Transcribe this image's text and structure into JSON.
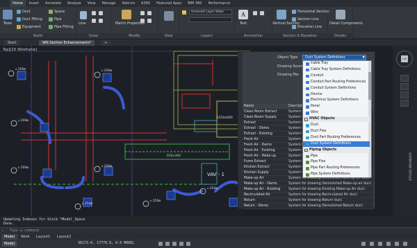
{
  "ribbon": {
    "tabs": [
      "Home",
      "Insert",
      "Annotate",
      "Analyze",
      "View",
      "Manage",
      "Add-ins",
      "A360",
      "Featured Apps",
      "BIM 360",
      "Performance"
    ],
    "active_tab": "Home",
    "build": {
      "tools": "Tools",
      "duct": "Duct",
      "duct_fitting": "Duct Fitting",
      "equipment": "Equipment",
      "space": "Space",
      "pipe": "Pipe",
      "pipe_fitting": "Pipe Fitting",
      "title": "Build"
    },
    "draw": {
      "line": "Line",
      "title": "Draw"
    },
    "modify": {
      "match_properties": "Match Properties",
      "title": "Modify"
    },
    "view": {
      "title": "View"
    },
    "layers": {
      "layer_state": "Unsaved Layer State",
      "title": "Layers"
    },
    "annotation": {
      "text": "Text",
      "title": "Annotation"
    },
    "section": {
      "vertical_section": "Vertical Section",
      "horizontal_section": "Horizontal Section",
      "section_line": "Section Line",
      "elevation_line": "Elevation Line",
      "title": "Section & Elevation"
    },
    "details": {
      "detail_components": "Detail Components",
      "title": "Details"
    }
  },
  "doc_tabs": [
    "Start",
    "WN Section Enhancements*"
  ],
  "viewport_label": "Top][2D Wireframe]",
  "drawing": {
    "labels": [
      {
        "id": "A",
        "text": "200ø"
      },
      {
        "id": "A",
        "text": "200ø"
      },
      {
        "id": "A",
        "text": "200ø"
      },
      {
        "id": "A",
        "text": "200ø"
      },
      {
        "id": "A",
        "text": "200ø"
      },
      {
        "id": "A",
        "text": "250ø"
      },
      {
        "id": "A",
        "text": "250ø"
      },
      {
        "id": "A",
        "text": "250ø"
      }
    ],
    "vav_label": "VAV - 1",
    "duct_size": "650x300",
    "tag": "1250x600"
  },
  "panel": {
    "object_type_label": "Object Type",
    "object_type_value": "Duct System Definitions",
    "drawing_source_label": "Drawing Source",
    "drawing_file_label": "Drawing File",
    "grid_header": {
      "name": "Name",
      "desc": "Description"
    },
    "rows": [
      {
        "name": "Clean Room Extract",
        "desc": "System for"
      },
      {
        "name": "Clean Room Supply",
        "desc": "System for"
      },
      {
        "name": "Extract",
        "desc": "System for"
      },
      {
        "name": "Extract - Demo",
        "desc": "System for"
      },
      {
        "name": "Extract - Existing",
        "desc": "System for"
      },
      {
        "name": "Fresh Air",
        "desc": "System for"
      },
      {
        "name": "Fresh Air - Demo",
        "desc": "System for"
      },
      {
        "name": "Fresh Air - Existing",
        "desc": "System for"
      },
      {
        "name": "Fresh Air - Make-up",
        "desc": "System for"
      },
      {
        "name": "Fume Extract",
        "desc": "System for"
      },
      {
        "name": "Kitchen Extract",
        "desc": "System for"
      },
      {
        "name": "Kitchen Supply",
        "desc": "System for"
      },
      {
        "name": "Make-up Air",
        "desc": "System for drawing Unfinished Make-up air duct."
      },
      {
        "name": "Make-up Air - Demo",
        "desc": "System for drawing Demolished Make-up air duct."
      },
      {
        "name": "Make-up Air - Existing",
        "desc": "System for drawing Existing Make-up Air duct."
      },
      {
        "name": "Recirculated Air",
        "desc": "System for drawing Recirculated Air duct."
      },
      {
        "name": "Return",
        "desc": "System for drawing Return duct."
      },
      {
        "name": "Return - Demo",
        "desc": "System for drawing Demolished Return duct."
      }
    ]
  },
  "dropdown": [
    {
      "type": "item",
      "label": "Cable Tray",
      "color": "#3b7bd4"
    },
    {
      "type": "item",
      "label": "Cable Tray System Definitions",
      "color": "#3b7bd4"
    },
    {
      "type": "item",
      "label": "Conduit",
      "color": "#3b7bd4"
    },
    {
      "type": "item",
      "label": "Conduit Part Routing Preferences",
      "color": "#3b7bd4"
    },
    {
      "type": "item",
      "label": "Conduit System Definitions",
      "color": "#3b7bd4"
    },
    {
      "type": "item",
      "label": "Device",
      "color": "#3b7bd4"
    },
    {
      "type": "item",
      "label": "Electrical System Definitions",
      "color": "#3b7bd4"
    },
    {
      "type": "item",
      "label": "Panel",
      "color": "#3b7bd4"
    },
    {
      "type": "item",
      "label": "Wire",
      "color": "#3b7bd4"
    },
    {
      "type": "group",
      "label": "HVAC Objects",
      "toggle": "-"
    },
    {
      "type": "item",
      "label": "Duct",
      "color": "#3aa0c8"
    },
    {
      "type": "item",
      "label": "Duct Flex",
      "color": "#3aa0c8"
    },
    {
      "type": "item",
      "label": "Duct Part Routing Preferences",
      "color": "#3aa0c8"
    },
    {
      "type": "item",
      "label": "Duct System Definitions",
      "color": "#3aa0c8",
      "selected": true
    },
    {
      "type": "group",
      "label": "Piping Objects",
      "toggle": "-"
    },
    {
      "type": "item",
      "label": "Pipe",
      "color": "#5b8f3a"
    },
    {
      "type": "item",
      "label": "Pipe Flex",
      "color": "#5b8f3a"
    },
    {
      "type": "item",
      "label": "Pipe Part Routing Preferences",
      "color": "#5b8f3a"
    },
    {
      "type": "item",
      "label": "Pipe System Definitions",
      "color": "#5b8f3a"
    }
  ],
  "right_strip": {
    "viewcube_face": "TOP",
    "styles_browser": "STYLES BROWSER"
  },
  "command": {
    "history_1": "Updating Indexes for block *Model_Space",
    "history_2": "Done.",
    "prompt": "Type a command"
  },
  "layout_tabs": [
    "Model",
    "Work",
    "Layout1",
    "Layout2"
  ],
  "status": {
    "coords": "36173.0, 17779.6, 0.0",
    "mode": "MODEL",
    "model_button": "Model"
  }
}
